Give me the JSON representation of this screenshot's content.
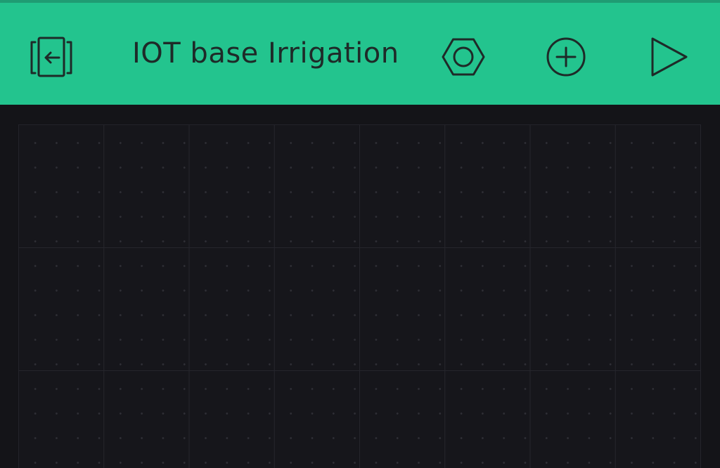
{
  "toolbar": {
    "title": "IOT base Irrigation",
    "background_color": "#23c48e",
    "icon_color": "#1e2a28",
    "buttons": {
      "back": {
        "icon": "exit-to-projects-icon"
      },
      "settings": {
        "icon": "hexagon-settings-icon"
      },
      "add": {
        "icon": "plus-circle-icon"
      },
      "play": {
        "icon": "play-icon"
      }
    }
  },
  "workspace": {
    "background_color": "#141418",
    "grid_columns": 8,
    "grid_rows": 3
  }
}
